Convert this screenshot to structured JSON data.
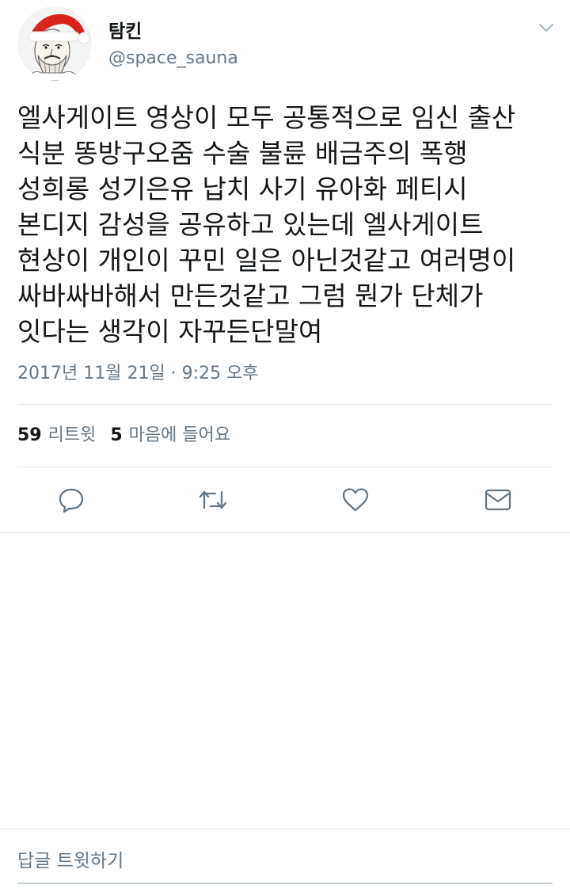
{
  "user": {
    "display_name": "탐킨",
    "username": "@space_sauna",
    "avatar_icon": "santa-hat-portrait-avatar"
  },
  "more_icon": "chevron-down-icon",
  "tweet": {
    "lines": [
      "엘사게이트 영상이 모두 공통적으로 임신 출산",
      "식분 똥방구오줌 수술 불륜 배금주의 폭행",
      "성희롱 성기은유 납치 사기 유아화 페티시",
      "본디지 감성을 공유하고 있는데 엘사게이트",
      "현상이 개인이 꾸민 일은 아닌것같고 여러명이",
      "싸바싸바해서 만든것같고 그럼 뭔가 단체가",
      "잇다는 생각이 자꾸든단말여"
    ],
    "timestamp": "2017년 11월 21일 · 9:25 오후"
  },
  "stats": {
    "retweets_count": "59",
    "retweets_label": "리트윗",
    "likes_count": "5",
    "likes_label": "마음에 들어요"
  },
  "actions": {
    "reply_icon": "reply-icon",
    "retweet_icon": "retweet-icon",
    "like_icon": "heart-icon",
    "message_icon": "envelope-icon"
  },
  "reply": {
    "placeholder": "답글 트윗하기"
  },
  "colors": {
    "text": "#14171a",
    "secondary": "#657786",
    "divider": "#e1e8ed",
    "icon": "#657786"
  }
}
